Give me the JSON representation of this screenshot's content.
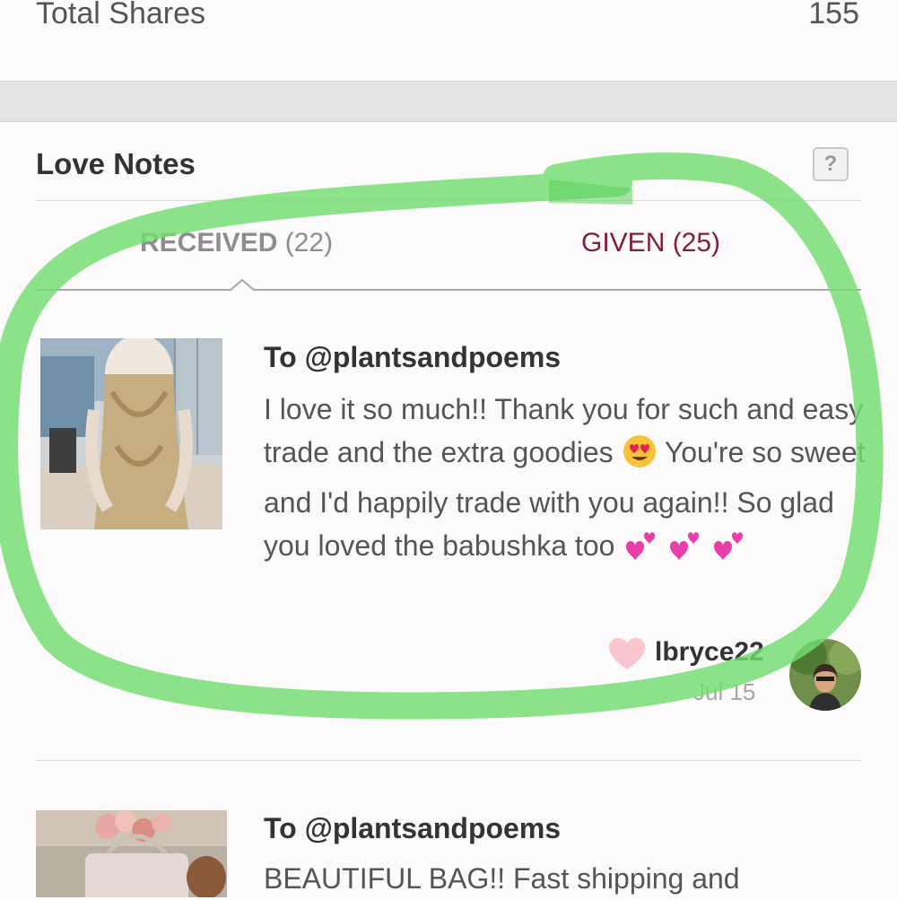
{
  "stats": {
    "label": "Total Shares",
    "value": "155"
  },
  "love_notes": {
    "title": "Love Notes",
    "help_label": "?",
    "tabs": {
      "received_label": "RECEIVED",
      "received_count": "(22)",
      "given_label": "GIVEN (25)"
    },
    "notes": [
      {
        "to": "To @plantsandpoems",
        "body_part1": "I love it so much!! Thank you for such and easy trade and the extra goodies",
        "body_part2": " You're so sweet and I'd happily trade with you again!! So glad you loved the babushka too ",
        "user": "lbryce22",
        "date": "Jul 15"
      },
      {
        "to": "To @plantsandpoems",
        "body": "BEAUTIFUL BAG!! Fast shipping and"
      }
    ]
  },
  "icons": {
    "help": "question-icon",
    "like": "heart-icon",
    "emoji_eyes": "heart-eyes-emoji",
    "emoji_hearts": "two-hearts-emoji",
    "tab_indicator": "caret-up-icon"
  },
  "colors": {
    "given_tab": "#7f1f35",
    "received_tab": "#8d8d8d",
    "like_heart": "#f9c6cf",
    "highlight_marker": "#72dd70"
  }
}
